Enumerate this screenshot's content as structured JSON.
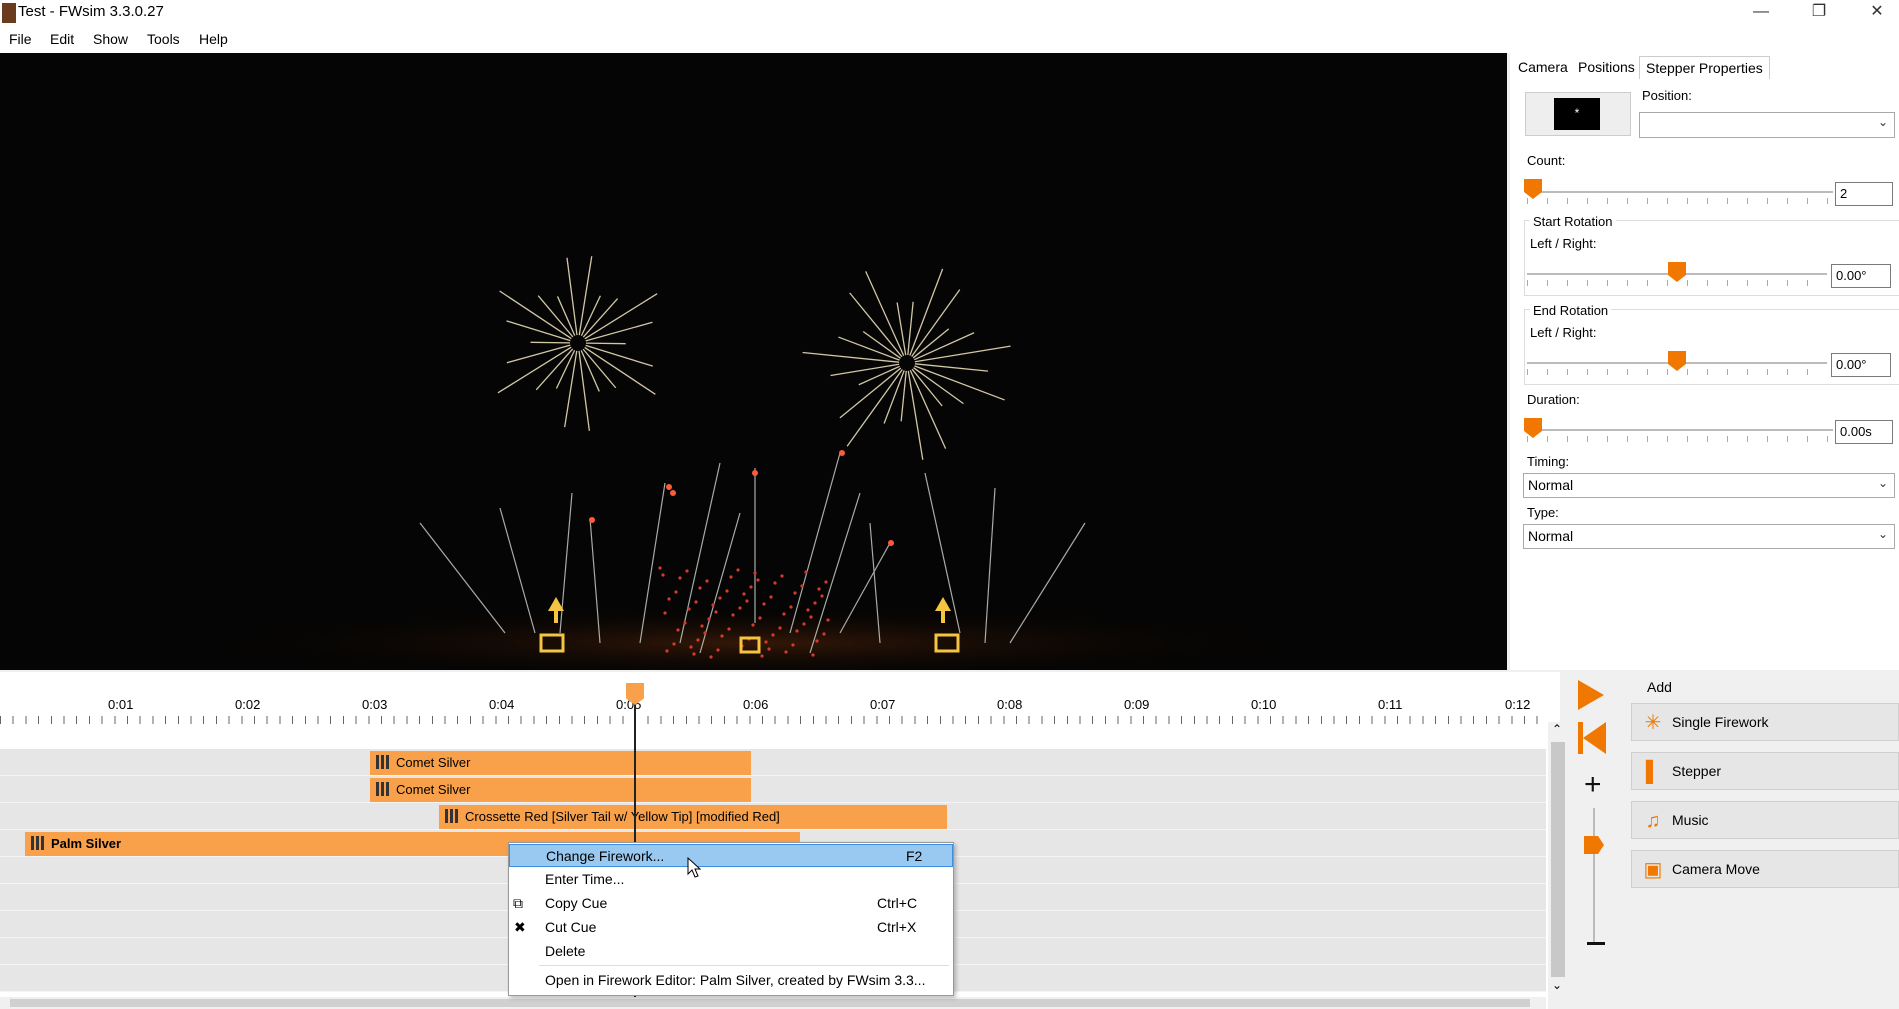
{
  "window": {
    "title": "Test - FWsim 3.3.0.27"
  },
  "menu": {
    "items": [
      "File",
      "Edit",
      "Show",
      "Tools",
      "Help"
    ]
  },
  "props": {
    "tabs": [
      "Camera",
      "Positions",
      "Stepper Properties"
    ],
    "position_label": "Position:",
    "position_value": "",
    "count_label": "Count:",
    "count_value": "2",
    "start_rotation_title": "Start Rotation",
    "start_rotation_label": "Left / Right:",
    "start_rotation_value": "0.00°",
    "end_rotation_title": "End Rotation",
    "end_rotation_label": "Left / Right:",
    "end_rotation_value": "0.00°",
    "duration_label": "Duration:",
    "duration_value": "0.00s",
    "timing_label": "Timing:",
    "timing_value": "Normal",
    "type_label": "Type:",
    "type_value": "Normal"
  },
  "timeline": {
    "ticks": [
      "0:01",
      "0:02",
      "0:03",
      "0:04",
      "0:05",
      "0:06",
      "0:07",
      "0:08",
      "0:09",
      "0:10",
      "0:11",
      "0:12"
    ],
    "cues": [
      "Comet Silver",
      "Comet Silver",
      "Crossette Red [Silver Tail w/ Yellow Tip] [modified Red]",
      "Palm Silver"
    ]
  },
  "context_menu": {
    "items": [
      {
        "label": "Change Firework...",
        "shortcut": "F2"
      },
      {
        "label": "Enter Time...",
        "shortcut": ""
      },
      {
        "label": "Copy Cue",
        "shortcut": "Ctrl+C"
      },
      {
        "label": "Cut Cue",
        "shortcut": "Ctrl+X"
      },
      {
        "label": "Delete",
        "shortcut": ""
      },
      {
        "label": "Open in Firework Editor: Palm Silver, created by FWsim 3.3...",
        "shortcut": ""
      }
    ]
  },
  "add_panel": {
    "title": "Add",
    "buttons": [
      "Single Firework",
      "Stepper",
      "Music",
      "Camera Move"
    ]
  },
  "colors": {
    "accent": "#f07800",
    "cue": "#f9a04a",
    "highlight": "#99c9f0"
  }
}
